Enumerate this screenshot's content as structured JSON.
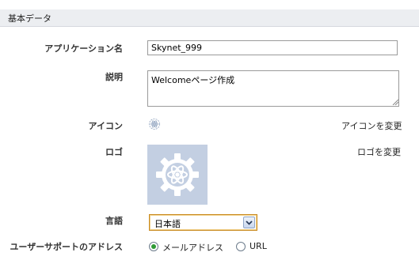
{
  "section": {
    "title": "基本データ"
  },
  "labels": {
    "app_name": "アプリケーション名",
    "description": "説明",
    "icon": "アイコン",
    "logo": "ロゴ",
    "language": "言語",
    "support_address": "ユーザーサポートのアドレス"
  },
  "fields": {
    "app_name_value": "Skynet_999",
    "description_value": "Welcomeページ作成",
    "language_value": "日本語"
  },
  "links": {
    "change_icon": "アイコンを変更",
    "change_logo": "ロゴを変更"
  },
  "support_options": [
    {
      "label": "メールアドレス",
      "checked": true
    },
    {
      "label": "URL",
      "checked": false
    }
  ],
  "icons": {
    "app_icon": "atom-gear-icon",
    "logo": "atom-gear-icon",
    "dropdown": "chevron-down-icon"
  },
  "colors": {
    "header_bg": "#eceef1",
    "logo_bg": "#c3cfe2",
    "select_border": "#c98a1f",
    "radio_checked": "#2f9a35"
  }
}
